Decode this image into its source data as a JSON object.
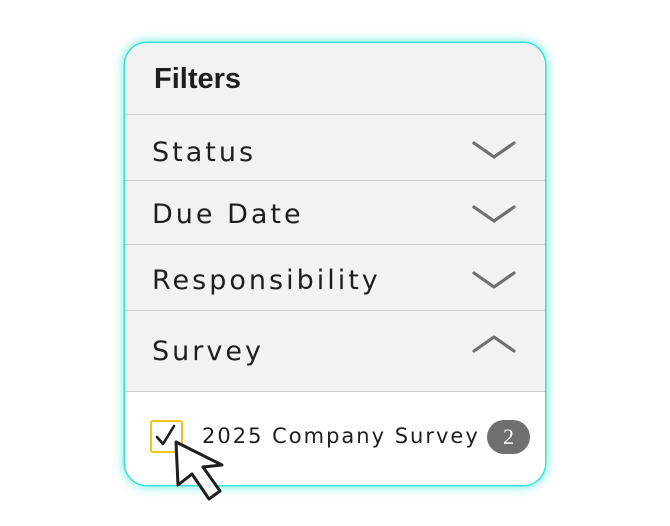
{
  "filters": {
    "title": "Filters",
    "sections": [
      {
        "label": "Status",
        "expanded": false,
        "icon": "chevron-down-icon"
      },
      {
        "label": "Due Date",
        "expanded": false,
        "icon": "chevron-down-icon"
      },
      {
        "label": "Responsibility",
        "expanded": false,
        "icon": "chevron-down-icon"
      },
      {
        "label": "Survey",
        "expanded": true,
        "icon": "chevron-up-icon"
      }
    ],
    "survey_options": [
      {
        "label": "2025 Company Survey",
        "checked": true,
        "count": "2"
      }
    ]
  },
  "colors": {
    "panel_glow": "#34e3d6",
    "checkbox_border": "#f2c41a",
    "badge_background": "#6f6f6f",
    "header_background": "#f3f2f2"
  },
  "cursor": {
    "icon": "mouse-pointer-icon"
  }
}
